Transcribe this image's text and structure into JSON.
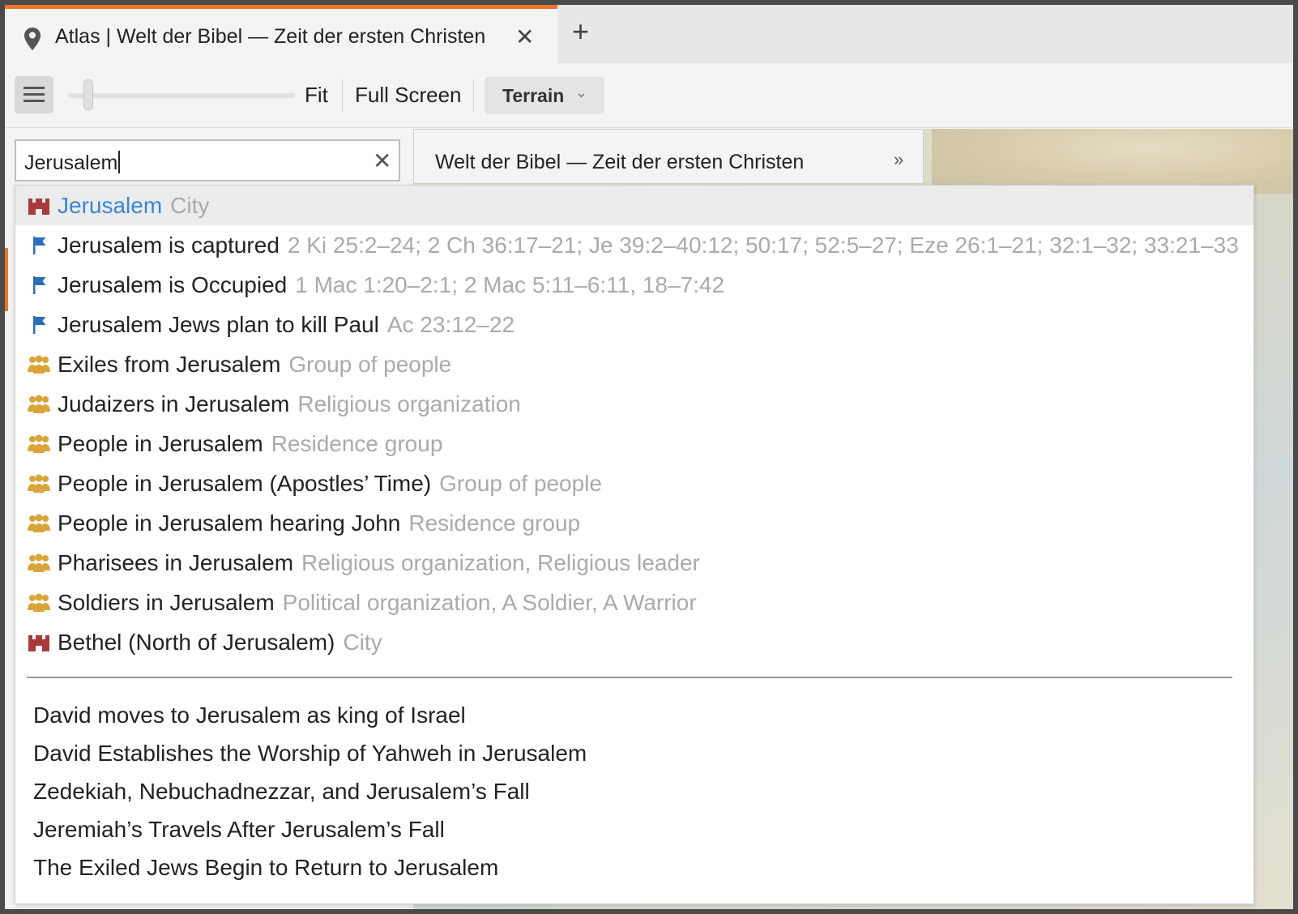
{
  "tab": {
    "title": "Atlas | Welt der Bibel — Zeit der ersten Christen",
    "close": "✕",
    "add": "+"
  },
  "toolbar": {
    "fit": "Fit",
    "full_screen": "Full Screen",
    "map_style": "Terrain",
    "zoom_level_fraction": 0.07
  },
  "map": {
    "title": "Welt der Bibel — Zeit der ersten Christen"
  },
  "search": {
    "value": "Jerusalem",
    "clear": "✕"
  },
  "results": [
    {
      "icon": "city-icon",
      "name": "Jerusalem",
      "desc": "City",
      "active": true
    },
    {
      "icon": "event-flag-icon",
      "name": "Jerusalem is captured",
      "desc": "2 Ki 25:2–24; 2 Ch 36:17–21; Je 39:2–40:12; 50:17; 52:5–27; Eze 26:1–21; 32:1–32; 33:21–33"
    },
    {
      "icon": "event-flag-icon",
      "name": "Jerusalem is Occupied",
      "desc": "1 Mac 1:20–2:1; 2 Mac 5:11–6:11, 18–7:42"
    },
    {
      "icon": "event-flag-icon",
      "name": "Jerusalem Jews plan to kill Paul",
      "desc": "Ac 23:12–22"
    },
    {
      "icon": "people-group-icon",
      "name": "Exiles from Jerusalem",
      "desc": "Group of people"
    },
    {
      "icon": "people-group-icon",
      "name": "Judaizers in Jerusalem",
      "desc": "Religious organization"
    },
    {
      "icon": "people-group-icon",
      "name": "People in Jerusalem",
      "desc": "Residence group"
    },
    {
      "icon": "people-group-icon",
      "name": "People in Jerusalem (Apostles’ Time)",
      "desc": "Group of people"
    },
    {
      "icon": "people-group-icon",
      "name": "People in Jerusalem hearing John",
      "desc": "Residence group"
    },
    {
      "icon": "people-group-icon",
      "name": "Pharisees in Jerusalem",
      "desc": "Religious organization, Religious leader"
    },
    {
      "icon": "people-group-icon",
      "name": "Soldiers in Jerusalem",
      "desc": "Political organization, A Soldier, A Warrior"
    },
    {
      "icon": "city-icon",
      "name": "Bethel (North of Jerusalem)",
      "desc": "City"
    }
  ],
  "articles": [
    "David moves to Jerusalem as king of Israel",
    "David Establishes the Worship of Yahweh in Jerusalem",
    "Zedekiah, Nebuchadnezzar, and Jerusalem’s Fall",
    "Jeremiah’s Travels After Jerusalem’s Fall",
    "The Exiled Jews Begin to Return to Jerusalem"
  ],
  "colors": {
    "accent": "#e8762d",
    "link_blue": "#3a86d8",
    "city_icon": "#a83a3a",
    "flag_icon": "#2a6fb8",
    "group_icon": "#d9a53a",
    "muted_text": "#aaaaaa"
  }
}
